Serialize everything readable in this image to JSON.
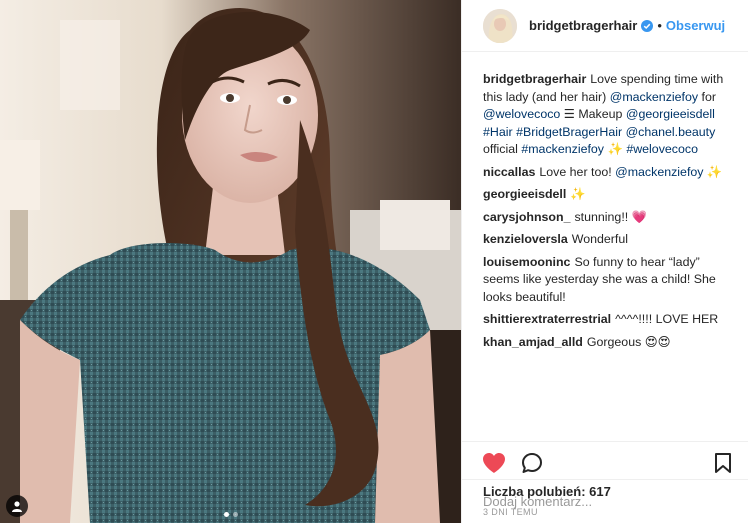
{
  "post": {
    "author": "bridgetbragerhair",
    "separator": "•",
    "follow_label": "Obserwuj",
    "caption": {
      "parts": [
        {
          "t": "Love spending time with this lady (and her hair) "
        },
        {
          "t": "@mackenziefoy",
          "link": true
        },
        {
          "t": " for "
        },
        {
          "t": "@welovecoco",
          "link": true
        },
        {
          "t": " ☰ Makeup "
        },
        {
          "t": "@georgieeisdell",
          "link": true
        },
        {
          "t": " "
        },
        {
          "t": "#Hair",
          "link": true
        },
        {
          "t": " "
        },
        {
          "t": "#BridgetBragerHair",
          "link": true
        },
        {
          "t": " "
        },
        {
          "t": "@chanel.beauty",
          "link": true
        },
        {
          "t": " official "
        },
        {
          "t": "#mackenziefoy",
          "link": true
        },
        {
          "t": " ✨ "
        },
        {
          "t": "#welovecoco",
          "link": true
        }
      ]
    },
    "comments": [
      {
        "user": "niccallas",
        "parts": [
          {
            "t": "Love her too! "
          },
          {
            "t": "@mackenziefoy",
            "link": true
          },
          {
            "t": " ✨"
          }
        ]
      },
      {
        "user": "georgieeisdell",
        "parts": [
          {
            "t": "✨"
          }
        ]
      },
      {
        "user": "carysjohnson_",
        "parts": [
          {
            "t": "stunning!! 💗"
          }
        ]
      },
      {
        "user": "kenzieloversla",
        "parts": [
          {
            "t": "Wonderful"
          }
        ]
      },
      {
        "user": "louisemooninc",
        "parts": [
          {
            "t": "So funny to hear “lady” seems like yesterday she was a child! She looks beautiful!"
          }
        ]
      },
      {
        "user": "shittierextraterrestrial",
        "parts": [
          {
            "t": "^^^^!!!! LOVE HER"
          }
        ]
      },
      {
        "user": "khan_amjad_alld",
        "parts": [
          {
            "t": "Gorgeous 😍😍"
          }
        ]
      }
    ],
    "likes_label": "Liczba polubień: 617",
    "time_label": "3 DNI TEMU",
    "comment_placeholder": "Dodaj komentarz...",
    "carousel": {
      "count": 2,
      "active": 0
    }
  },
  "icons": {
    "verified": "verified-badge-icon",
    "like": "heart-icon",
    "comment": "comment-bubble-icon",
    "save": "bookmark-icon",
    "tag": "user-tag-icon"
  },
  "colors": {
    "accent": "#3897f0",
    "like_red": "#ed4956",
    "text": "#262626",
    "muted": "#999999",
    "link": "#003569"
  }
}
